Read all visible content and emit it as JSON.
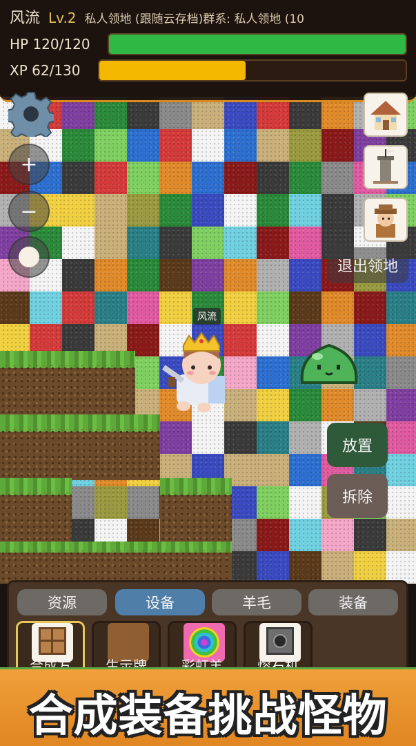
{
  "player": {
    "name": "风流",
    "level": "Lv.2",
    "info": "私人领地 (跟随云存档)群系: 私人领地 (10",
    "hp_text": "HP 120/120",
    "xp_text": "XP 62/130",
    "hp_fraction": 1.0,
    "xp_fraction": 0.477,
    "hp_color": "#2fb843",
    "xp_color": "#f5b800"
  },
  "controls": {
    "settings_icon": "gear-icon",
    "zoom_in": "+",
    "zoom_out": "−"
  },
  "right_buttons": {
    "home_icon": "house-icon",
    "tower_icon": "tower-icon",
    "character_icon": "explorer-icon",
    "exit_label": "退出领地"
  },
  "actions": {
    "place_label": "放置",
    "remove_label": "拆除",
    "place_color": "#2f5a3a",
    "remove_color": "#6b5d55"
  },
  "character": {
    "name_tag": "风流"
  },
  "panel": {
    "tabs": [
      "资源",
      "设备",
      "羊毛",
      "装备"
    ],
    "active_tab": 1,
    "items": [
      {
        "label": "合成方",
        "icon": "crafting-table-icon"
      },
      {
        "label": "生示牌",
        "icon": "sign-icon"
      },
      {
        "label": "彩虹羊",
        "icon": "rainbow-sheep-icon"
      },
      {
        "label": "熔石机",
        "icon": "machine-icon"
      }
    ]
  },
  "banner": {
    "text": "合成装备挑战怪物"
  }
}
